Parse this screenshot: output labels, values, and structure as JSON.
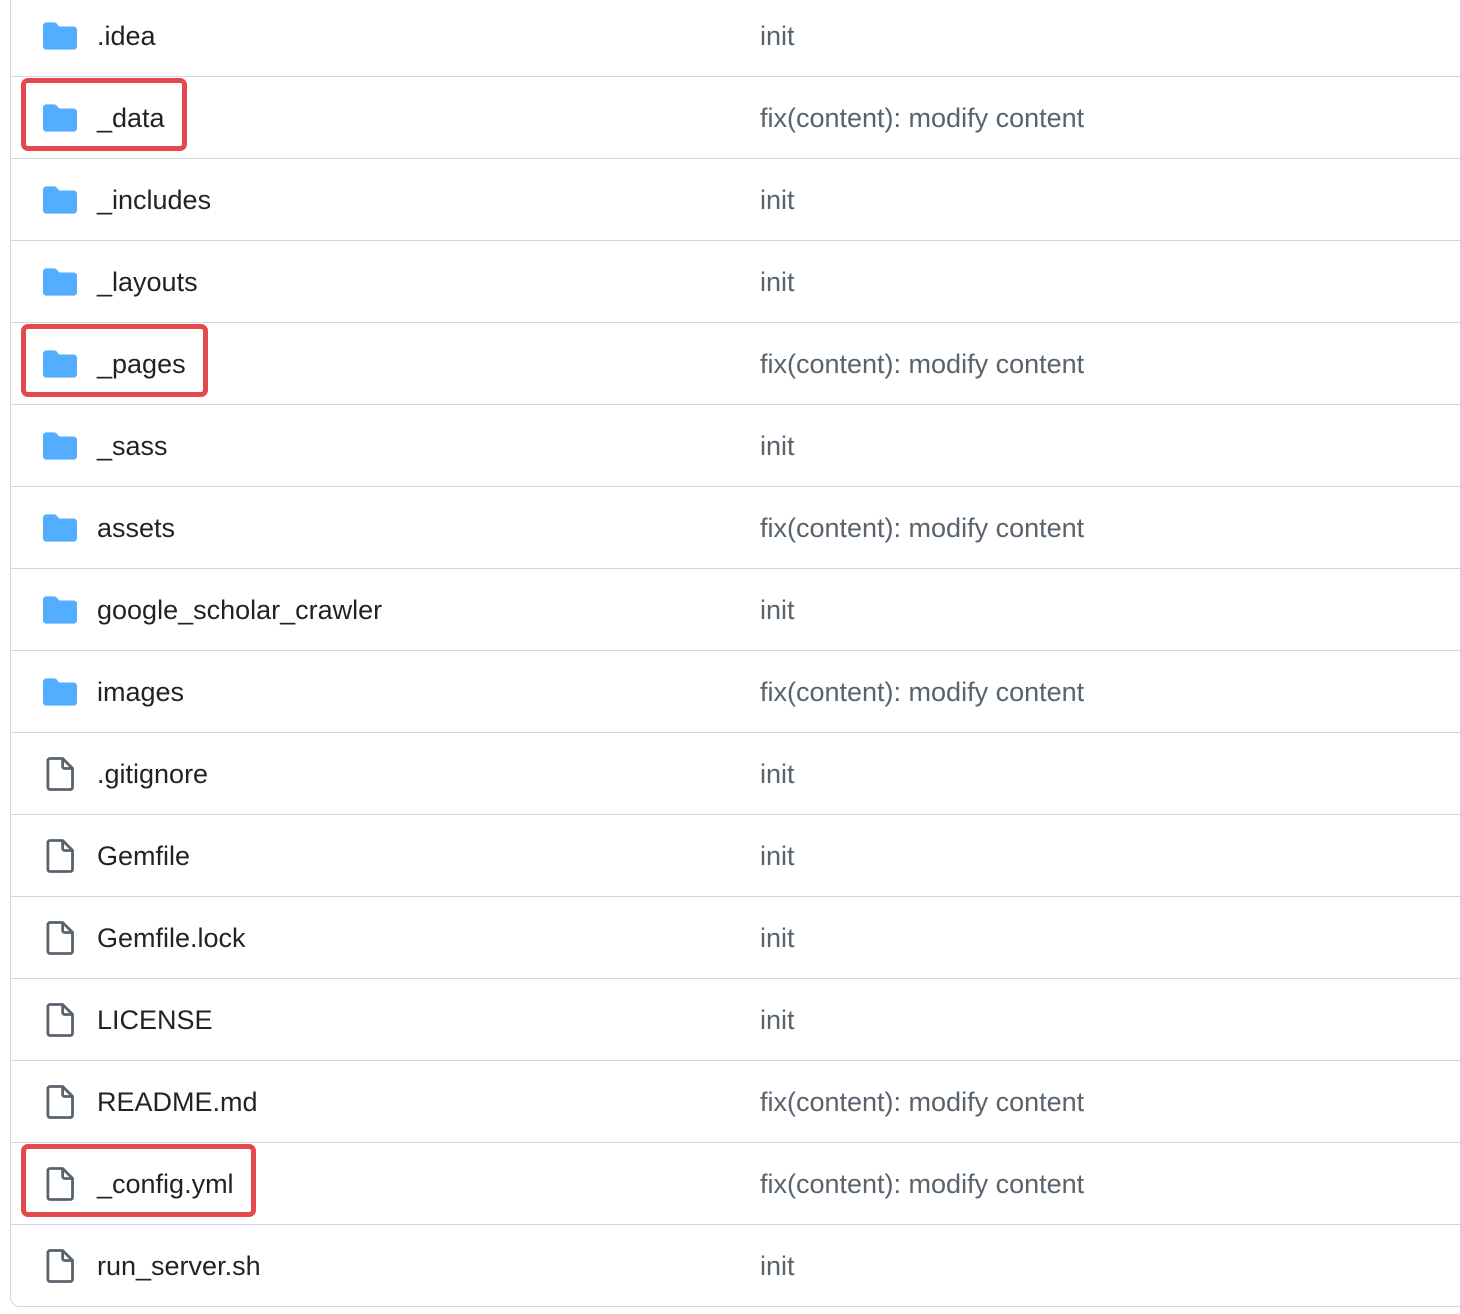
{
  "colors": {
    "folder_icon": "#54aeff",
    "file_icon": "#59636e",
    "highlight_border": "#e5484d",
    "row_divider": "#d0d7de",
    "commit_text": "#59636e"
  },
  "files": [
    {
      "name": ".idea",
      "type": "folder",
      "icon": "folder-icon",
      "commit": "init",
      "highlighted": false
    },
    {
      "name": "_data",
      "type": "folder",
      "icon": "folder-icon",
      "commit": "fix(content): modify content",
      "highlighted": true
    },
    {
      "name": "_includes",
      "type": "folder",
      "icon": "folder-icon",
      "commit": "init",
      "highlighted": false
    },
    {
      "name": "_layouts",
      "type": "folder",
      "icon": "folder-icon",
      "commit": "init",
      "highlighted": false
    },
    {
      "name": "_pages",
      "type": "folder",
      "icon": "folder-icon",
      "commit": "fix(content): modify content",
      "highlighted": true
    },
    {
      "name": "_sass",
      "type": "folder",
      "icon": "folder-icon",
      "commit": "init",
      "highlighted": false
    },
    {
      "name": "assets",
      "type": "folder",
      "icon": "folder-icon",
      "commit": "fix(content): modify content",
      "highlighted": false
    },
    {
      "name": "google_scholar_crawler",
      "type": "folder",
      "icon": "folder-icon",
      "commit": "init",
      "highlighted": false
    },
    {
      "name": "images",
      "type": "folder",
      "icon": "folder-icon",
      "commit": "fix(content): modify content",
      "highlighted": false
    },
    {
      "name": ".gitignore",
      "type": "file",
      "icon": "file-icon",
      "commit": "init",
      "highlighted": false
    },
    {
      "name": "Gemfile",
      "type": "file",
      "icon": "file-icon",
      "commit": "init",
      "highlighted": false
    },
    {
      "name": "Gemfile.lock",
      "type": "file",
      "icon": "file-icon",
      "commit": "init",
      "highlighted": false
    },
    {
      "name": "LICENSE",
      "type": "file",
      "icon": "file-icon",
      "commit": "init",
      "highlighted": false
    },
    {
      "name": "README.md",
      "type": "file",
      "icon": "file-icon",
      "commit": "fix(content): modify content",
      "highlighted": false
    },
    {
      "name": "_config.yml",
      "type": "file",
      "icon": "file-icon",
      "commit": "fix(content): modify content",
      "highlighted": true
    },
    {
      "name": "run_server.sh",
      "type": "file",
      "icon": "file-icon",
      "commit": "init",
      "highlighted": false
    }
  ]
}
